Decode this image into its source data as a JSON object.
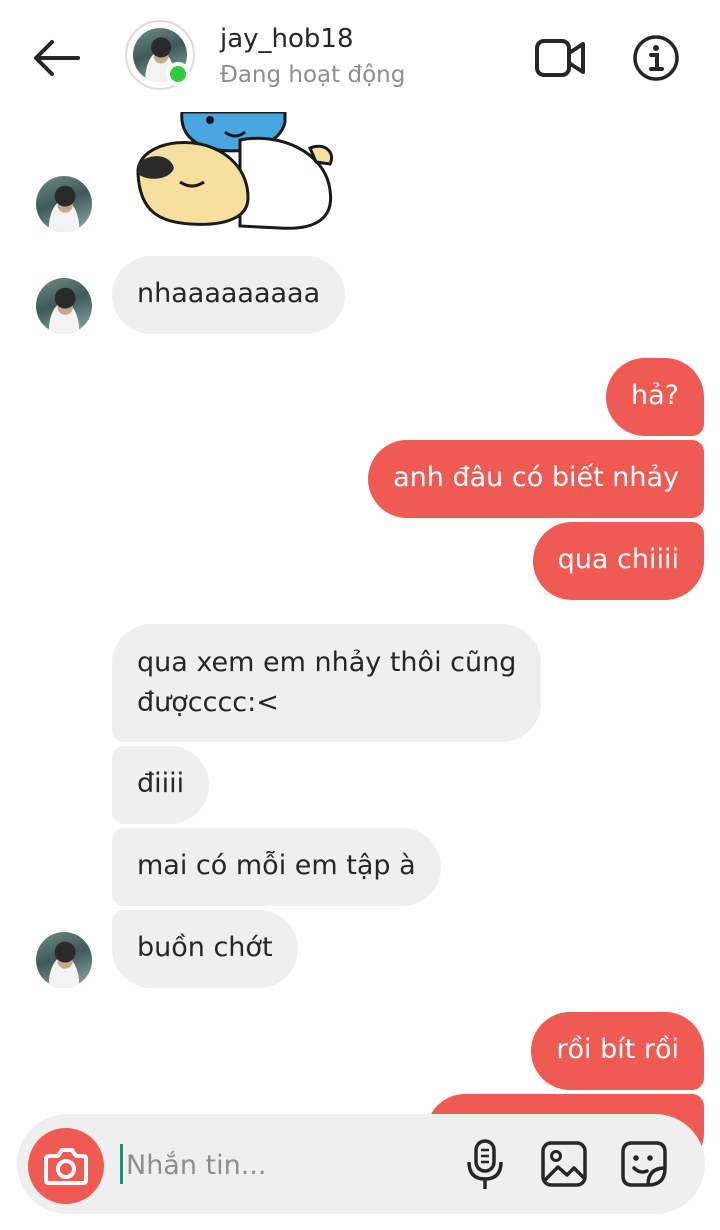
{
  "header": {
    "username": "jay_hob18",
    "status": "Đang hoạt động"
  },
  "messages": [
    {
      "side": "in",
      "text": "nhaaaaaaaaa"
    },
    {
      "side": "out",
      "text": "hả?"
    },
    {
      "side": "out",
      "text": "anh đâu có biết nhảy"
    },
    {
      "side": "out",
      "text": "qua chiiii"
    },
    {
      "side": "in",
      "line1": "qua xem em nhảy thôi cũng",
      "line2": "đượcccc:<"
    },
    {
      "side": "in",
      "text": "điiii"
    },
    {
      "side": "in",
      "text": "mai có mỗi em tập à"
    },
    {
      "side": "in",
      "text": "buồn chớt"
    },
    {
      "side": "out",
      "text": "rồi bít rồi"
    },
    {
      "side": "out",
      "text": ""
    }
  ],
  "composer": {
    "placeholder": "Nhắn tin..."
  },
  "icons": {
    "back": "arrow-left-icon",
    "video": "video-camera-icon",
    "info": "info-icon",
    "camera": "camera-icon",
    "mic": "microphone-icon",
    "gallery": "image-icon",
    "sticker": "sticker-icon"
  },
  "colors": {
    "outgoing_bubble": "#ef5a52",
    "incoming_bubble": "#efefef",
    "online": "#2ecc40"
  }
}
